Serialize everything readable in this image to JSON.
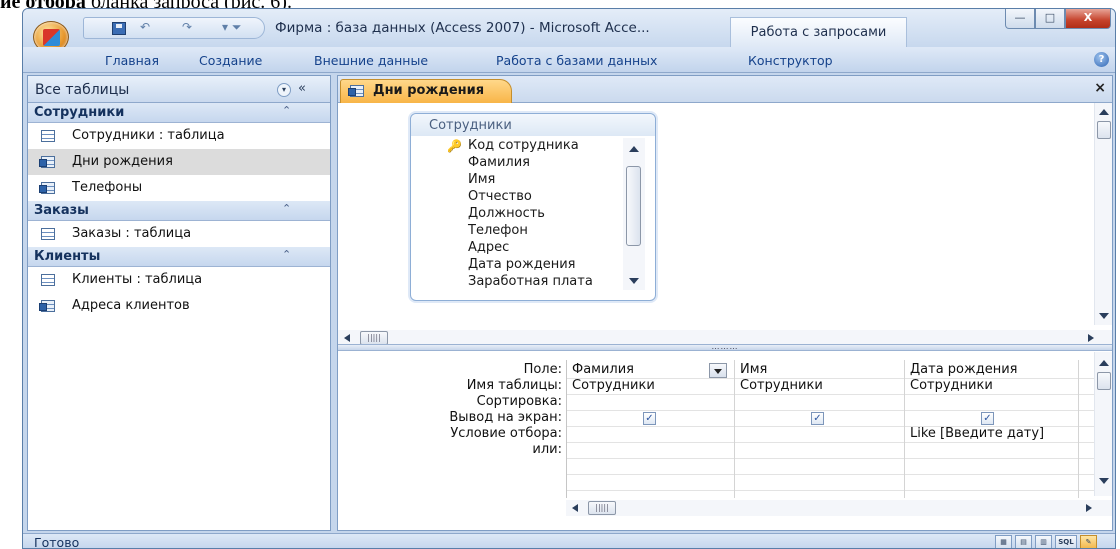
{
  "page_caption": {
    "bold": "ие отбора",
    "rest": " бланка запроса (рис. 6)."
  },
  "window": {
    "title": "Фирма : база данных (Access 2007) - Microsoft Acce...",
    "context_tab": "Работа с запросами",
    "min_label": "—",
    "max_label": "□",
    "close_label": "X"
  },
  "qat": {
    "undo": "↶",
    "redo": "↷",
    "more": "▾ ⏷"
  },
  "ribbon": {
    "tabs": [
      "Главная",
      "Создание",
      "Внешние данные",
      "Работа с базами данных",
      "Конструктор"
    ],
    "help": "?"
  },
  "nav": {
    "title": "Все таблицы",
    "dropdown": "▾",
    "collapse": "«",
    "groups": [
      {
        "name": "Сотрудники",
        "chev": "⌃",
        "items": [
          {
            "label": "Сотрудники : таблица",
            "icon": "table-icon"
          },
          {
            "label": "Дни рождения",
            "icon": "query-icon",
            "selected": true
          },
          {
            "label": "Телефоны",
            "icon": "query-icon"
          }
        ]
      },
      {
        "name": "Заказы",
        "chev": "⌃",
        "items": [
          {
            "label": "Заказы : таблица",
            "icon": "table-icon"
          }
        ]
      },
      {
        "name": "Клиенты",
        "chev": "⌃",
        "items": [
          {
            "label": "Клиенты : таблица",
            "icon": "table-icon"
          },
          {
            "label": "Адреса клиентов",
            "icon": "query-icon"
          }
        ]
      }
    ]
  },
  "doc": {
    "tab_label": "Дни рождения",
    "close": "×",
    "splitter": "………"
  },
  "field_list": {
    "title": "Сотрудники",
    "key_icon": "key-icon",
    "fields": [
      "Код сотрудника",
      "Фамилия",
      "Имя",
      "Отчество",
      "Должность",
      "Телефон",
      "Адрес",
      "Дата рождения",
      "Заработная плата"
    ]
  },
  "design_grid": {
    "row_labels": [
      "Поле:",
      "Имя таблицы:",
      "Сортировка:",
      "Вывод на экран:",
      "Условие отбора:",
      "или:"
    ],
    "columns": [
      {
        "field": "Фамилия",
        "table": "Сотрудники",
        "sort": "",
        "show": true,
        "criteria": ""
      },
      {
        "field": "Имя",
        "table": "Сотрудники",
        "sort": "",
        "show": true,
        "criteria": ""
      },
      {
        "field": "Дата рождения",
        "table": "Сотрудники",
        "sort": "",
        "show": true,
        "criteria": "Like [Введите дату]"
      }
    ],
    "check_mark": "✓",
    "hthumb_label": "|||||"
  },
  "status": {
    "text": "Готово",
    "view_buttons": [
      "▦",
      "▤",
      "▥",
      "SQL",
      "✎"
    ]
  },
  "colors": {
    "accent": "#15428b",
    "active_tab": "#f8b548",
    "frame": "#c5d6ec"
  }
}
